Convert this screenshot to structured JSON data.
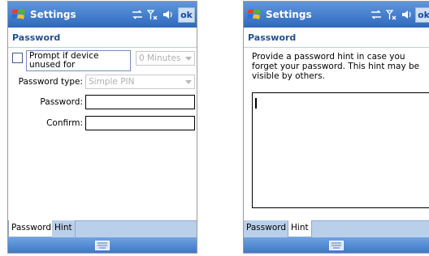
{
  "left": {
    "title": "Settings",
    "ok_label": "ok",
    "heading": "Password",
    "prompt_label": "Prompt if device unused for",
    "minutes_value": "0 Minutes",
    "password_type_label": "Password type:",
    "password_type_value": "Simple PIN",
    "password_label": "Password:",
    "password_value": "",
    "confirm_label": "Confirm:",
    "confirm_value": "",
    "tabs": [
      "Password",
      "Hint"
    ],
    "active_tab": "Password"
  },
  "right": {
    "title": "Settings",
    "ok_label": "ok",
    "heading": "Password",
    "hint_instructions": "Provide a password hint in case you forget your password.  This hint may be visible by others.",
    "hint_value": "",
    "tabs": [
      "Password",
      "Hint"
    ],
    "active_tab": "Hint"
  },
  "colors": {
    "titlebar": "#3a74c8",
    "heading": "#24518f",
    "tabstrip": "#bad0ea"
  }
}
